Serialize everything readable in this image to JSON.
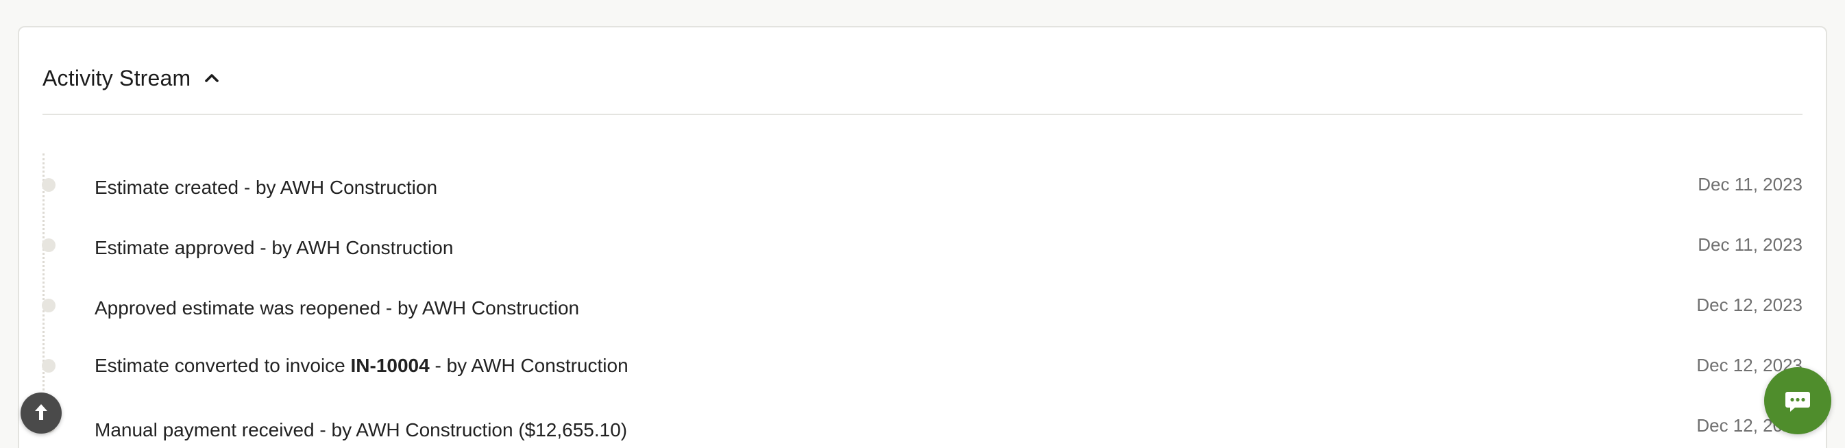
{
  "activity_stream": {
    "title": "Activity Stream",
    "chevron_icon": "chevron-up-icon",
    "items": [
      {
        "text_before": "Estimate created - by AWH Construction",
        "emphasis": "",
        "text_after": "",
        "date": "Dec 11, 2023"
      },
      {
        "text_before": "Estimate approved - by AWH Construction",
        "emphasis": "",
        "text_after": "",
        "date": "Dec 11, 2023"
      },
      {
        "text_before": "Approved estimate was reopened - by AWH Construction",
        "emphasis": "",
        "text_after": "",
        "date": "Dec 12, 2023"
      },
      {
        "text_before": "Estimate converted to invoice ",
        "emphasis": "IN-10004",
        "text_after": " - by AWH Construction",
        "date": "Dec 12, 2023"
      },
      {
        "text_before": "Manual payment received - by AWH Construction ($12,655.10)",
        "emphasis": "",
        "text_after": "",
        "date": "Dec 12, 2023"
      }
    ]
  },
  "floating_buttons": {
    "scroll_top_icon": "arrow-up-icon",
    "chat_icon": "chat-bubble-icon"
  },
  "colors": {
    "chat_button": "#4f8d2c",
    "scroll_top_button": "#4a4a4a",
    "timeline_dot": "#e7e5df"
  }
}
